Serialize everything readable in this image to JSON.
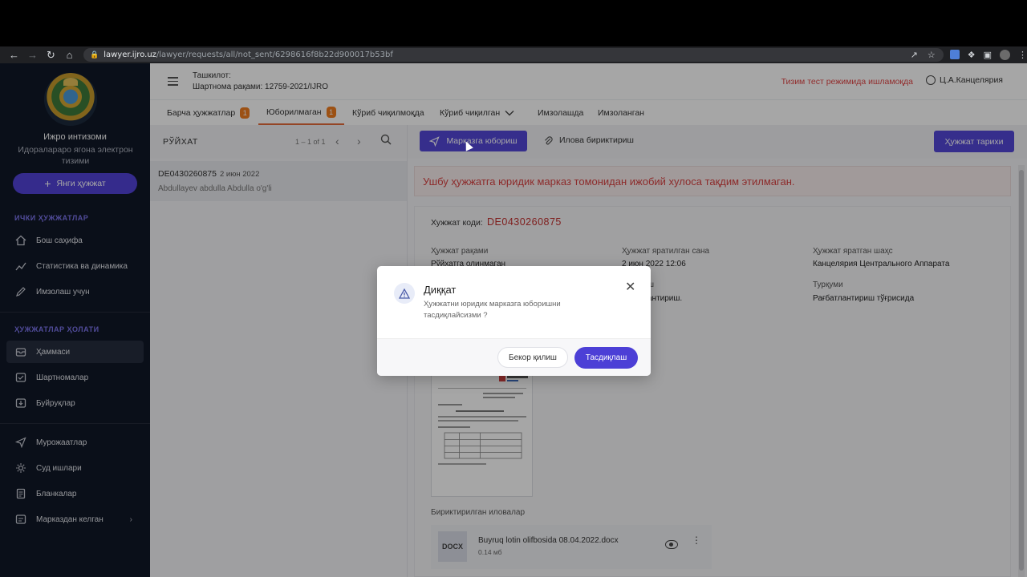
{
  "browser": {
    "url_host": "lawyer.ijro.uz",
    "url_path": "/lawyer/requests/all/not_sent/6298616f8b22d900017b53bf"
  },
  "sidebar": {
    "org_title": "Ижро интизоми",
    "org_subtitle": "Идоралараро ягона электрон тизими",
    "new_doc_label": "Янги ҳужжат",
    "section_internal": "ИЧКИ ҲУЖЖАТЛАР",
    "internal_items": [
      {
        "label": "Бош саҳифа",
        "icon": "home-icon"
      },
      {
        "label": "Статистика ва динамика",
        "icon": "chart-icon"
      },
      {
        "label": "Имзолаш учун",
        "icon": "sign-icon"
      }
    ],
    "section_status": "ҲУЖЖАТЛАР ҲОЛАТИ",
    "status_items": [
      {
        "label": "Ҳаммаси",
        "icon": "inbox-icon",
        "active": true
      },
      {
        "label": "Шартномалар",
        "icon": "contract-icon"
      },
      {
        "label": "Буйруқлар",
        "icon": "order-icon"
      }
    ],
    "other_items": [
      {
        "label": "Мурожаатлар",
        "icon": "send-icon"
      },
      {
        "label": "Суд ишлари",
        "icon": "court-icon"
      },
      {
        "label": "Бланкалар",
        "icon": "forms-icon"
      },
      {
        "label": "Марказдан келган",
        "icon": "center-icon"
      }
    ]
  },
  "header": {
    "org_label": "Ташкилот:",
    "contract_label": "Шартнома рақами:",
    "contract_number": "12759-2021/IJRO",
    "test_mode": "Тизим тест режимида ишламоқда",
    "user_name": "Ц.А.Канцелярия"
  },
  "tabs": [
    {
      "label": "Барча ҳужжатлар",
      "badge": "1"
    },
    {
      "label": "Юборилмаган",
      "badge": "1",
      "active": true
    },
    {
      "label": "Кўриб чиқилмоқда"
    },
    {
      "label": "Кўриб чиқилган"
    },
    {
      "label": "Имзолашда"
    },
    {
      "label": "Имзоланган"
    }
  ],
  "list": {
    "title": "РЎЙХАТ",
    "pager": "1 – 1 of 1",
    "rows": [
      {
        "code": "DE0430260875",
        "date": "2 июн 2022",
        "person": "Abdullayev abdulla Abdulla o'g'li"
      }
    ]
  },
  "actions": {
    "send_label": "Марказга юбориш",
    "attach_label": "Илова бириктириш",
    "history_label": "Ҳужжат тарихи"
  },
  "alert": "Ушбу ҳужжатга юридик марказ томонидан ижобий хулоса тақдим этилмаган.",
  "document": {
    "code_label": "Хужжат коди:",
    "code_value": "DE0430260875",
    "fields": [
      {
        "label": "Ҳужжат рақами",
        "value": "Рўйхатга олинмаган"
      },
      {
        "label": "Ҳужжат яратилган сана",
        "value": "2 июн 2022 12:06"
      },
      {
        "label": "Ҳужжат яратган шаҳс",
        "value": "Канцелярия Центрального Аппарата"
      },
      {
        "label": "Турқуми",
        "value": "Рағбатлантириш тўғрисида"
      }
    ],
    "partial_label_1": "ш",
    "partial_value_1": "антириш.",
    "attachments_title": "Бириктирилган иловалар",
    "file": {
      "type": "DOCX",
      "name": "Buyruq lotin olifbosida 08.04.2022.docx",
      "size": "0.14 мб"
    }
  },
  "modal": {
    "title": "Диққат",
    "text": "Ҳужжатни юридик марказга юборишни тасдиқлайсизми ?",
    "cancel_label": "Бекор қилиш",
    "confirm_label": "Тасдиқлаш"
  },
  "colors": {
    "primary": "#5447d8",
    "sidebar_bg": "#101727",
    "alert_red": "#d94343",
    "badge_orange": "#f07d1f"
  }
}
